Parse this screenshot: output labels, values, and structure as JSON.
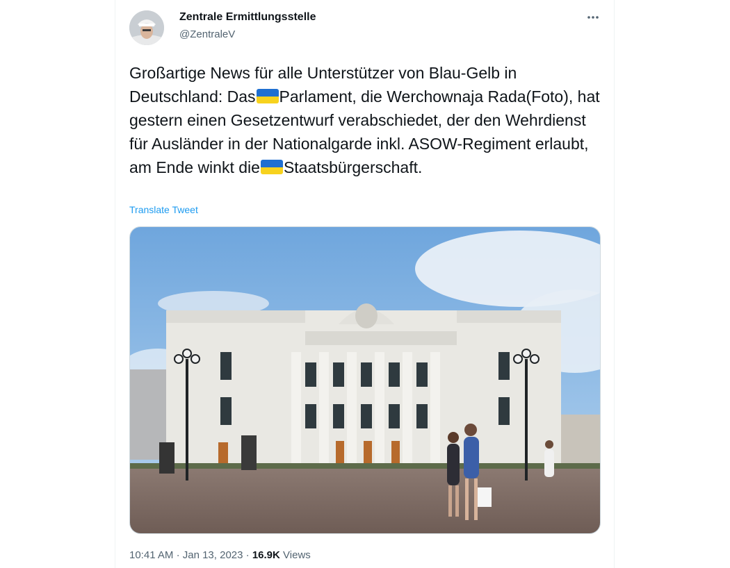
{
  "author": {
    "display_name": "Zentrale Ermittlungsstelle",
    "handle": "@ZentraleV"
  },
  "tweet": {
    "text_1": "Großartige News für alle Unterstützer von Blau-Gelb in Deutschland: Das",
    "text_2": "Parlament, die Werchownaja Rada(Foto), hat gestern einen Gesetzentwurf verabschiedet, der den Wehrdienst für Ausländer in der Nationalgarde inkl. ASOW-Regiment erlaubt, am Ende winkt die",
    "text_3": "Staatsbürgerschaft.",
    "translate_label": "Translate Tweet"
  },
  "footer": {
    "time": "10:41 AM",
    "separator": "·",
    "date": "Jan 13, 2023",
    "views_count": "16.9K",
    "views_label": "Views"
  },
  "icons": {
    "more": "more-horizontal-icon",
    "flag": "ukraine-flag-emoji"
  },
  "colors": {
    "link": "#1d9bf0",
    "secondary_text": "#536471",
    "flag_blue": "#1f6fd1",
    "flag_yellow": "#f7d21e"
  }
}
